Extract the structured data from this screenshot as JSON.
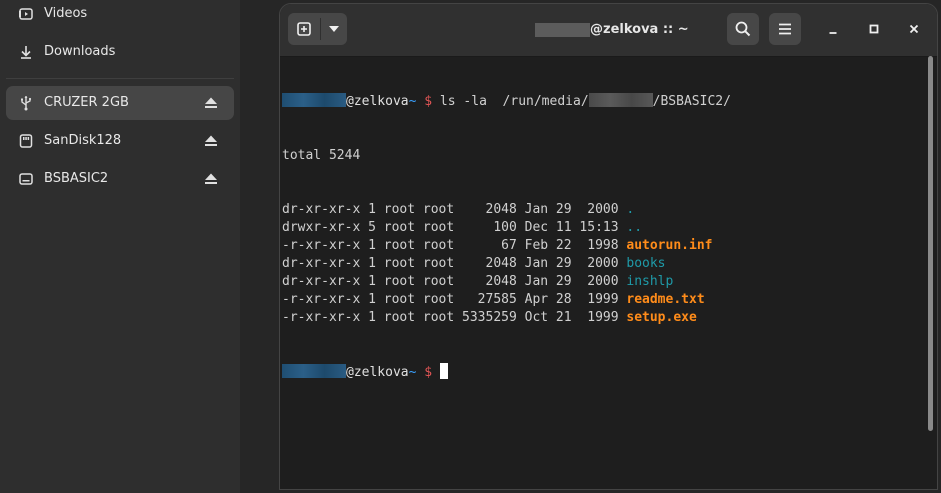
{
  "sidebar": {
    "items": [
      {
        "label": "Videos",
        "icon": "video-folder-icon"
      },
      {
        "label": "Downloads",
        "icon": "download-icon"
      }
    ],
    "devices": [
      {
        "label": "CRUZER 2GB",
        "icon": "usb-icon",
        "active": true
      },
      {
        "label": "SanDisk128",
        "icon": "drive-icon",
        "active": false
      },
      {
        "label": "BSBASIC2",
        "icon": "drive-icon",
        "active": false
      }
    ]
  },
  "terminal": {
    "title_suffix": "@zelkova :: ~",
    "buttons": {
      "new_tab": "new-tab-icon",
      "dropdown": "chevron-down-icon",
      "search": "search-icon",
      "menu": "hamburger-menu-icon",
      "minimize": "minimize-icon",
      "maximize": "maximize-icon",
      "close": "close-icon"
    },
    "prompt": {
      "host": "@zelkova",
      "tilde": "~",
      "dollar": "$"
    },
    "command": {
      "text_before": " ls -la  /run/media/",
      "text_after": "/BSBASIC2/"
    },
    "total": "total 5244",
    "entries": [
      {
        "prefix": "dr-xr-xr-x 1 root root    2048 Jan 29  2000 ",
        "name": ".",
        "kind": "dir"
      },
      {
        "prefix": "drwxr-xr-x 5 root root     100 Dec 11 15:13 ",
        "name": "..",
        "kind": "dir"
      },
      {
        "prefix": "-r-xr-xr-x 1 root root      67 Feb 22  1998 ",
        "name": "autorun.inf",
        "kind": "exec"
      },
      {
        "prefix": "dr-xr-xr-x 1 root root    2048 Jan 29  2000 ",
        "name": "books",
        "kind": "dir"
      },
      {
        "prefix": "dr-xr-xr-x 1 root root    2048 Jan 29  2000 ",
        "name": "inshlp",
        "kind": "dir"
      },
      {
        "prefix": "-r-xr-xr-x 1 root root   27585 Apr 28  1999 ",
        "name": "readme.txt",
        "kind": "exec"
      },
      {
        "prefix": "-r-xr-xr-x 1 root root 5335259 Oct 21  1999 ",
        "name": "setup.exe",
        "kind": "exec"
      }
    ],
    "colors": {
      "directory": "#1e9aa8",
      "executable": "#ff8c1a",
      "tilde": "#3aa1ff",
      "dollar": "#e05555"
    }
  }
}
